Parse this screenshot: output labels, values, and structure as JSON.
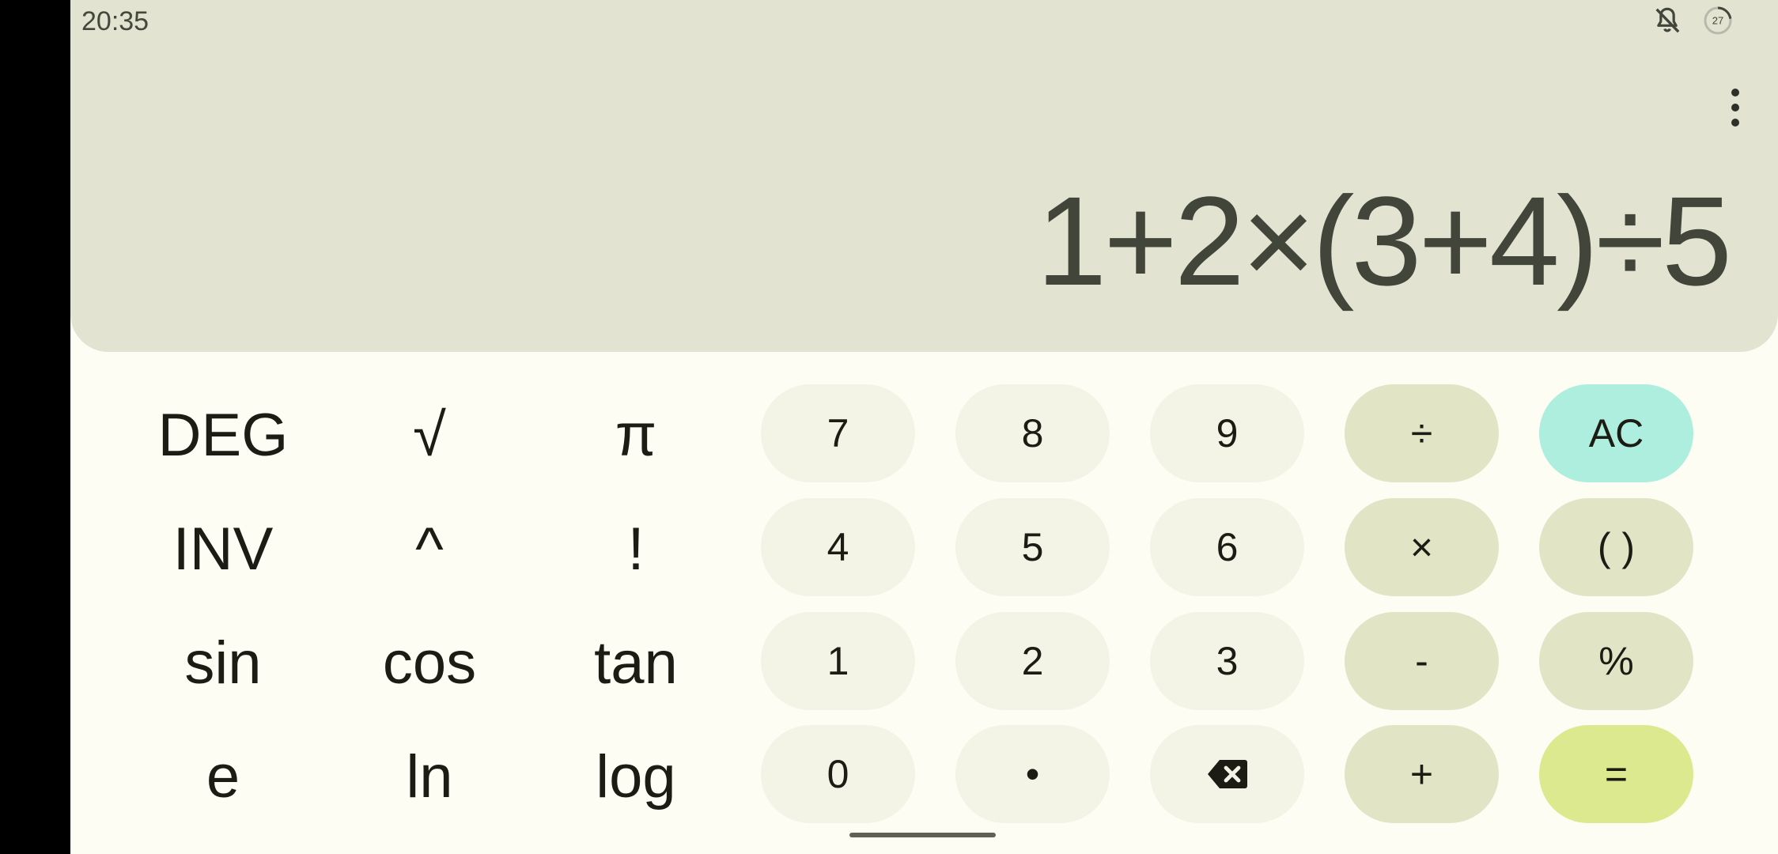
{
  "status_bar": {
    "time": "20:35",
    "battery_level": "27"
  },
  "display": {
    "expression": "1+2×(3+4)÷5"
  },
  "scientific_keys": {
    "deg": "DEG",
    "sqrt": "√",
    "pi": "π",
    "inv": "INV",
    "power": "^",
    "factorial": "!",
    "sin": "sin",
    "cos": "cos",
    "tan": "tan",
    "e": "e",
    "ln": "ln",
    "log": "log"
  },
  "keypad": {
    "k7": "7",
    "k8": "8",
    "k9": "9",
    "divide": "÷",
    "ac": "AC",
    "k4": "4",
    "k5": "5",
    "k6": "6",
    "multiply": "×",
    "parens": "( )",
    "k1": "1",
    "k2": "2",
    "k3": "3",
    "minus": "-",
    "percent": "%",
    "k0": "0",
    "dot": "•",
    "plus": "+",
    "equals": "="
  },
  "colors": {
    "display_bg": "#e2e4d1",
    "app_bg": "#fdfdf3",
    "number_key": "#f3f3e6",
    "operator_key": "#e1e5c6",
    "ac_key": "#adeedf",
    "equals_key": "#dde98f"
  }
}
